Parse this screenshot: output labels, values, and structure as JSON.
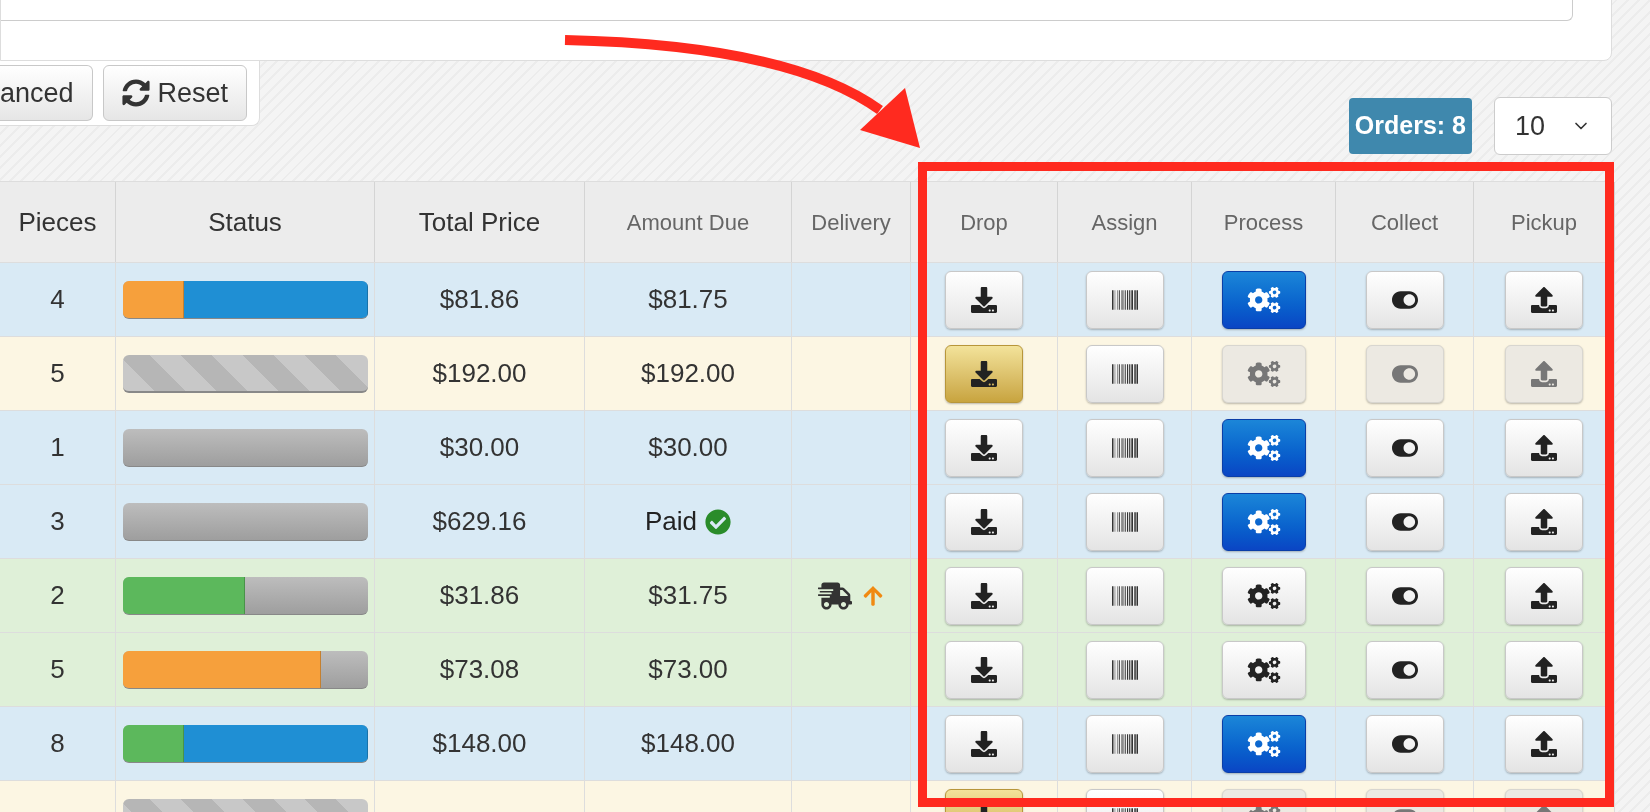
{
  "toolbar": {
    "buttons": [
      {
        "kind": "advanced",
        "label": "anced"
      },
      {
        "kind": "reset",
        "label": "Reset"
      }
    ]
  },
  "orders_badge": "Orders: 8",
  "page_size": {
    "value": "10"
  },
  "table": {
    "columns": [
      {
        "label": "Pieces",
        "kind": "primary"
      },
      {
        "label": "Status",
        "kind": "primary"
      },
      {
        "label": "Total Price",
        "kind": "primary"
      },
      {
        "label": "Amount Due",
        "kind": "secondary"
      },
      {
        "label": "Delivery",
        "kind": "secondary"
      },
      {
        "label": "Drop",
        "kind": "secondary"
      },
      {
        "label": "Assign",
        "kind": "secondary"
      },
      {
        "label": "Process",
        "kind": "secondary"
      },
      {
        "label": "Collect",
        "kind": "secondary"
      },
      {
        "label": "Pickup",
        "kind": "secondary"
      }
    ],
    "rows": [
      {
        "color": "#d9eaf5",
        "pieces": "4",
        "status": {
          "striped": false,
          "segments": [
            {
              "color": "#f6a03c",
              "level": 0.25
            },
            {
              "color": "#1f8fd4",
              "level": 0.75
            }
          ]
        },
        "total_price": "$81.86",
        "amount_due": "$81.75",
        "paid": false,
        "delivery": false,
        "actions": [
          {
            "kind": "drop",
            "active": false,
            "disabled": false
          },
          {
            "kind": "assign",
            "active": false,
            "disabled": false
          },
          {
            "kind": "process",
            "active": true,
            "disabled": false
          },
          {
            "kind": "collect",
            "active": false,
            "disabled": false
          },
          {
            "kind": "pickup",
            "active": false,
            "disabled": false
          }
        ]
      },
      {
        "color": "#fcf6e3",
        "pieces": "5",
        "status": {
          "striped": true
        },
        "total_price": "$192.00",
        "amount_due": "$192.00",
        "paid": false,
        "delivery": false,
        "actions": [
          {
            "kind": "drop",
            "active": true,
            "disabled": false
          },
          {
            "kind": "assign",
            "active": false,
            "disabled": false
          },
          {
            "kind": "process",
            "active": false,
            "disabled": true
          },
          {
            "kind": "collect",
            "active": false,
            "disabled": true
          },
          {
            "kind": "pickup",
            "active": false,
            "disabled": true
          }
        ]
      },
      {
        "color": "#d9eaf5",
        "pieces": "1",
        "status": {
          "striped": false
        },
        "total_price": "$30.00",
        "amount_due": "$30.00",
        "paid": false,
        "delivery": false,
        "actions": [
          {
            "kind": "drop",
            "active": false,
            "disabled": false
          },
          {
            "kind": "assign",
            "active": false,
            "disabled": false
          },
          {
            "kind": "process",
            "active": true,
            "disabled": false
          },
          {
            "kind": "collect",
            "active": false,
            "disabled": false
          },
          {
            "kind": "pickup",
            "active": false,
            "disabled": false
          }
        ]
      },
      {
        "color": "#d9eaf5",
        "pieces": "3",
        "status": {
          "striped": false
        },
        "total_price": "$629.16",
        "amount_due": "Paid",
        "paid": true,
        "delivery": false,
        "actions": [
          {
            "kind": "drop",
            "active": false,
            "disabled": false
          },
          {
            "kind": "assign",
            "active": false,
            "disabled": false
          },
          {
            "kind": "process",
            "active": true,
            "disabled": false
          },
          {
            "kind": "collect",
            "active": false,
            "disabled": false
          },
          {
            "kind": "pickup",
            "active": false,
            "disabled": false
          }
        ]
      },
      {
        "color": "#dff0d8",
        "pieces": "2",
        "status": {
          "striped": false,
          "segments": [
            {
              "color": "#5cb85c",
              "level": 0.5
            }
          ]
        },
        "total_price": "$31.86",
        "amount_due": "$31.75",
        "paid": false,
        "delivery": true,
        "actions": [
          {
            "kind": "drop",
            "active": false,
            "disabled": false
          },
          {
            "kind": "assign",
            "active": false,
            "disabled": false
          },
          {
            "kind": "process",
            "active": false,
            "disabled": false
          },
          {
            "kind": "collect",
            "active": false,
            "disabled": false
          },
          {
            "kind": "pickup",
            "active": false,
            "disabled": false
          }
        ]
      },
      {
        "color": "#dff0d8",
        "pieces": "5",
        "status": {
          "striped": false,
          "segments": [
            {
              "color": "#f6a03c",
              "level": 0.81
            }
          ]
        },
        "total_price": "$73.08",
        "amount_due": "$73.00",
        "paid": false,
        "delivery": false,
        "actions": [
          {
            "kind": "drop",
            "active": false,
            "disabled": false
          },
          {
            "kind": "assign",
            "active": false,
            "disabled": false
          },
          {
            "kind": "process",
            "active": false,
            "disabled": false
          },
          {
            "kind": "collect",
            "active": false,
            "disabled": false
          },
          {
            "kind": "pickup",
            "active": false,
            "disabled": false
          }
        ]
      },
      {
        "color": "#d9eaf5",
        "pieces": "8",
        "status": {
          "striped": false,
          "segments": [
            {
              "color": "#5cb85c",
              "level": 0.25
            },
            {
              "color": "#1f8fd4",
              "level": 0.75
            }
          ]
        },
        "total_price": "$148.00",
        "amount_due": "$148.00",
        "paid": false,
        "delivery": false,
        "actions": [
          {
            "kind": "drop",
            "active": false,
            "disabled": false
          },
          {
            "kind": "assign",
            "active": false,
            "disabled": false
          },
          {
            "kind": "process",
            "active": true,
            "disabled": false
          },
          {
            "kind": "collect",
            "active": false,
            "disabled": false
          },
          {
            "kind": "pickup",
            "active": false,
            "disabled": false
          }
        ]
      },
      {
        "color": "#fcf6e3",
        "status": {
          "striped": true
        },
        "actions": [
          {
            "kind": "drop",
            "active": true,
            "disabled": false
          },
          {
            "kind": "assign",
            "active": false,
            "disabled": false
          },
          {
            "kind": "process",
            "active": false,
            "disabled": true
          },
          {
            "kind": "collect",
            "active": false,
            "disabled": true
          },
          {
            "kind": "pickup",
            "active": false,
            "disabled": true
          }
        ]
      }
    ]
  }
}
